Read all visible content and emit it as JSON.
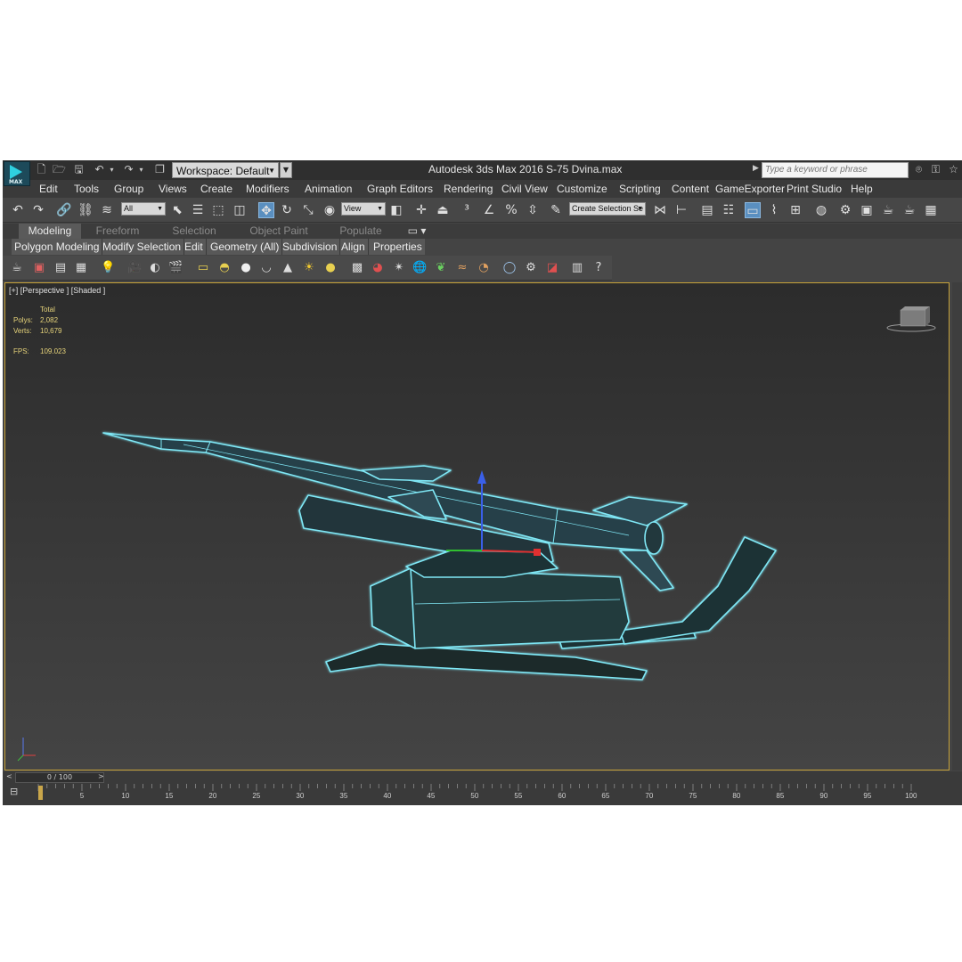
{
  "titlebar": {
    "workspace_label": "Workspace: Default",
    "app_title": "Autodesk 3ds Max 2016",
    "file_title": "S-75 Dvina.max",
    "search_placeholder": "Type a keyword or phrase",
    "logo_text": "MAX"
  },
  "menu": [
    "Edit",
    "Tools",
    "Group",
    "Views",
    "Create",
    "Modifiers",
    "Animation",
    "Graph Editors",
    "Rendering",
    "Civil View",
    "Customize",
    "Scripting",
    "Content",
    "GameExporter",
    "Print Studio",
    "Help"
  ],
  "toolbar": {
    "filter_value": "All",
    "ref_coord_value": "View",
    "named_selection_placeholder": "Create Selection Se"
  },
  "ribbon": {
    "tabs": [
      "Modeling",
      "Freeform",
      "Selection",
      "Object Paint",
      "Populate"
    ],
    "active_tab": "Modeling",
    "panels": [
      "Polygon Modeling",
      "Modify Selection",
      "Edit",
      "Geometry (All)",
      "Subdivision",
      "Align",
      "Properties"
    ]
  },
  "viewport": {
    "label": "[+] [Perspective ] [Shaded ]",
    "stats": {
      "total_label": "Total",
      "polys_label": "Polys:",
      "polys_value": "2,082",
      "verts_label": "Verts:",
      "verts_value": "10,679",
      "fps_label": "FPS:",
      "fps_value": "109.023"
    },
    "selection_color": "#7fe7f5",
    "border_color": "#c8a33a"
  },
  "timeline": {
    "slider_label": "0 / 100",
    "ticks": [
      "5",
      "10",
      "15",
      "20",
      "25",
      "30",
      "35",
      "40",
      "45",
      "50",
      "55",
      "60",
      "65",
      "70",
      "75",
      "80",
      "85",
      "90",
      "95",
      "100"
    ]
  }
}
